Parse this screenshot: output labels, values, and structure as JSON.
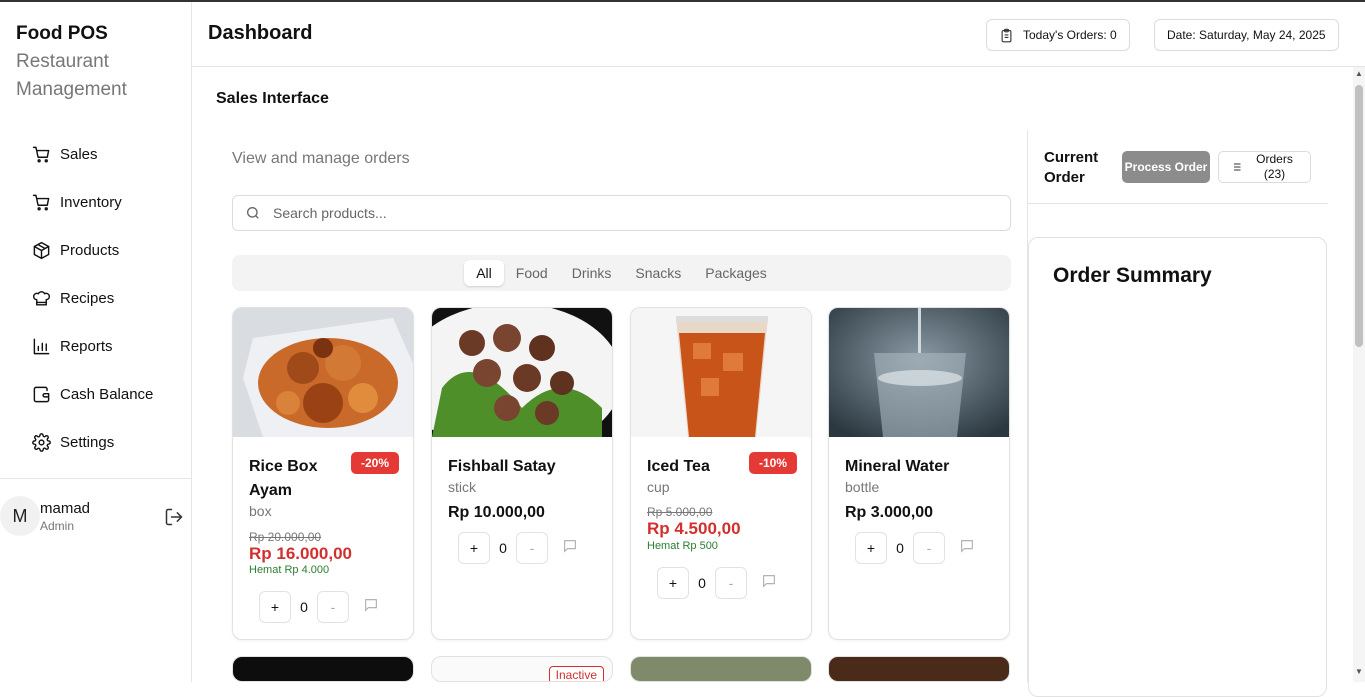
{
  "brand": {
    "title": "Food POS",
    "subtitle1": "Restaurant",
    "subtitle2": "Management"
  },
  "nav": [
    {
      "label": "Sales",
      "icon": "cart-icon"
    },
    {
      "label": "Inventory",
      "icon": "cart-icon"
    },
    {
      "label": "Products",
      "icon": "box-icon"
    },
    {
      "label": "Recipes",
      "icon": "chef-hat-icon"
    },
    {
      "label": "Reports",
      "icon": "bar-chart-icon"
    },
    {
      "label": "Cash Balance",
      "icon": "wallet-icon"
    },
    {
      "label": "Settings",
      "icon": "gear-icon"
    }
  ],
  "user": {
    "initial": "M",
    "name": "mamad",
    "role": "Admin"
  },
  "header": {
    "title": "Dashboard",
    "orders_chip": "Today's Orders: 0",
    "date_chip": "Date: Saturday, May 24, 2025"
  },
  "main": {
    "subtitle": "Sales Interface",
    "description": "View and manage orders",
    "search_placeholder": "Search products...",
    "tabs": [
      "All",
      "Food",
      "Drinks",
      "Snacks",
      "Packages"
    ],
    "active_tab": "All"
  },
  "products": [
    {
      "name": "Rice Box Ayam",
      "unit": "box",
      "badge": "-20%",
      "old_price": "Rp 20.000,00",
      "price": "Rp 16.000,00",
      "saving": "Hemat Rp 4.000",
      "qty": "0"
    },
    {
      "name": "Fishball Satay",
      "unit": "stick",
      "price": "Rp 10.000,00",
      "qty": "0"
    },
    {
      "name": "Iced Tea",
      "unit": "cup",
      "badge": "-10%",
      "old_price": "Rp 5.000,00",
      "price": "Rp 4.500,00",
      "saving": "Hemat Rp 500",
      "qty": "0"
    },
    {
      "name": "Mineral Water",
      "unit": "bottle",
      "price": "Rp 3.000,00",
      "qty": "0"
    }
  ],
  "second_row": {
    "inactive_label": "Inactive"
  },
  "order_panel": {
    "current_order": "Current Order",
    "process_button": "Process Order",
    "orders_button": "Orders (23)",
    "summary_title": "Order Summary"
  },
  "controls": {
    "plus": "+",
    "minus": "-"
  },
  "colors": {
    "discount": "#d32f2f",
    "saving": "#2e7d32",
    "badge": "#e53935"
  }
}
